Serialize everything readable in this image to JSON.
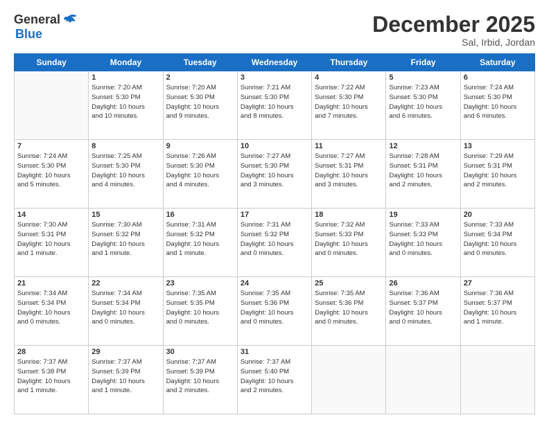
{
  "header": {
    "logo_line1": "General",
    "logo_line2": "Blue",
    "title": "December 2025",
    "subtitle": "Sal, Irbid, Jordan"
  },
  "days_of_week": [
    "Sunday",
    "Monday",
    "Tuesday",
    "Wednesday",
    "Thursday",
    "Friday",
    "Saturday"
  ],
  "weeks": [
    [
      {
        "day": "",
        "info": ""
      },
      {
        "day": "1",
        "info": "Sunrise: 7:20 AM\nSunset: 5:30 PM\nDaylight: 10 hours\nand 10 minutes."
      },
      {
        "day": "2",
        "info": "Sunrise: 7:20 AM\nSunset: 5:30 PM\nDaylight: 10 hours\nand 9 minutes."
      },
      {
        "day": "3",
        "info": "Sunrise: 7:21 AM\nSunset: 5:30 PM\nDaylight: 10 hours\nand 8 minutes."
      },
      {
        "day": "4",
        "info": "Sunrise: 7:22 AM\nSunset: 5:30 PM\nDaylight: 10 hours\nand 7 minutes."
      },
      {
        "day": "5",
        "info": "Sunrise: 7:23 AM\nSunset: 5:30 PM\nDaylight: 10 hours\nand 6 minutes."
      },
      {
        "day": "6",
        "info": "Sunrise: 7:24 AM\nSunset: 5:30 PM\nDaylight: 10 hours\nand 6 minutes."
      }
    ],
    [
      {
        "day": "7",
        "info": "Sunrise: 7:24 AM\nSunset: 5:30 PM\nDaylight: 10 hours\nand 5 minutes."
      },
      {
        "day": "8",
        "info": "Sunrise: 7:25 AM\nSunset: 5:30 PM\nDaylight: 10 hours\nand 4 minutes."
      },
      {
        "day": "9",
        "info": "Sunrise: 7:26 AM\nSunset: 5:30 PM\nDaylight: 10 hours\nand 4 minutes."
      },
      {
        "day": "10",
        "info": "Sunrise: 7:27 AM\nSunset: 5:30 PM\nDaylight: 10 hours\nand 3 minutes."
      },
      {
        "day": "11",
        "info": "Sunrise: 7:27 AM\nSunset: 5:31 PM\nDaylight: 10 hours\nand 3 minutes."
      },
      {
        "day": "12",
        "info": "Sunrise: 7:28 AM\nSunset: 5:31 PM\nDaylight: 10 hours\nand 2 minutes."
      },
      {
        "day": "13",
        "info": "Sunrise: 7:29 AM\nSunset: 5:31 PM\nDaylight: 10 hours\nand 2 minutes."
      }
    ],
    [
      {
        "day": "14",
        "info": "Sunrise: 7:30 AM\nSunset: 5:31 PM\nDaylight: 10 hours\nand 1 minute."
      },
      {
        "day": "15",
        "info": "Sunrise: 7:30 AM\nSunset: 5:32 PM\nDaylight: 10 hours\nand 1 minute."
      },
      {
        "day": "16",
        "info": "Sunrise: 7:31 AM\nSunset: 5:32 PM\nDaylight: 10 hours\nand 1 minute."
      },
      {
        "day": "17",
        "info": "Sunrise: 7:31 AM\nSunset: 5:32 PM\nDaylight: 10 hours\nand 0 minutes."
      },
      {
        "day": "18",
        "info": "Sunrise: 7:32 AM\nSunset: 5:33 PM\nDaylight: 10 hours\nand 0 minutes."
      },
      {
        "day": "19",
        "info": "Sunrise: 7:33 AM\nSunset: 5:33 PM\nDaylight: 10 hours\nand 0 minutes."
      },
      {
        "day": "20",
        "info": "Sunrise: 7:33 AM\nSunset: 5:34 PM\nDaylight: 10 hours\nand 0 minutes."
      }
    ],
    [
      {
        "day": "21",
        "info": "Sunrise: 7:34 AM\nSunset: 5:34 PM\nDaylight: 10 hours\nand 0 minutes."
      },
      {
        "day": "22",
        "info": "Sunrise: 7:34 AM\nSunset: 5:34 PM\nDaylight: 10 hours\nand 0 minutes."
      },
      {
        "day": "23",
        "info": "Sunrise: 7:35 AM\nSunset: 5:35 PM\nDaylight: 10 hours\nand 0 minutes."
      },
      {
        "day": "24",
        "info": "Sunrise: 7:35 AM\nSunset: 5:36 PM\nDaylight: 10 hours\nand 0 minutes."
      },
      {
        "day": "25",
        "info": "Sunrise: 7:35 AM\nSunset: 5:36 PM\nDaylight: 10 hours\nand 0 minutes."
      },
      {
        "day": "26",
        "info": "Sunrise: 7:36 AM\nSunset: 5:37 PM\nDaylight: 10 hours\nand 0 minutes."
      },
      {
        "day": "27",
        "info": "Sunrise: 7:36 AM\nSunset: 5:37 PM\nDaylight: 10 hours\nand 1 minute."
      }
    ],
    [
      {
        "day": "28",
        "info": "Sunrise: 7:37 AM\nSunset: 5:38 PM\nDaylight: 10 hours\nand 1 minute."
      },
      {
        "day": "29",
        "info": "Sunrise: 7:37 AM\nSunset: 5:39 PM\nDaylight: 10 hours\nand 1 minute."
      },
      {
        "day": "30",
        "info": "Sunrise: 7:37 AM\nSunset: 5:39 PM\nDaylight: 10 hours\nand 2 minutes."
      },
      {
        "day": "31",
        "info": "Sunrise: 7:37 AM\nSunset: 5:40 PM\nDaylight: 10 hours\nand 2 minutes."
      },
      {
        "day": "",
        "info": ""
      },
      {
        "day": "",
        "info": ""
      },
      {
        "day": "",
        "info": ""
      }
    ]
  ]
}
